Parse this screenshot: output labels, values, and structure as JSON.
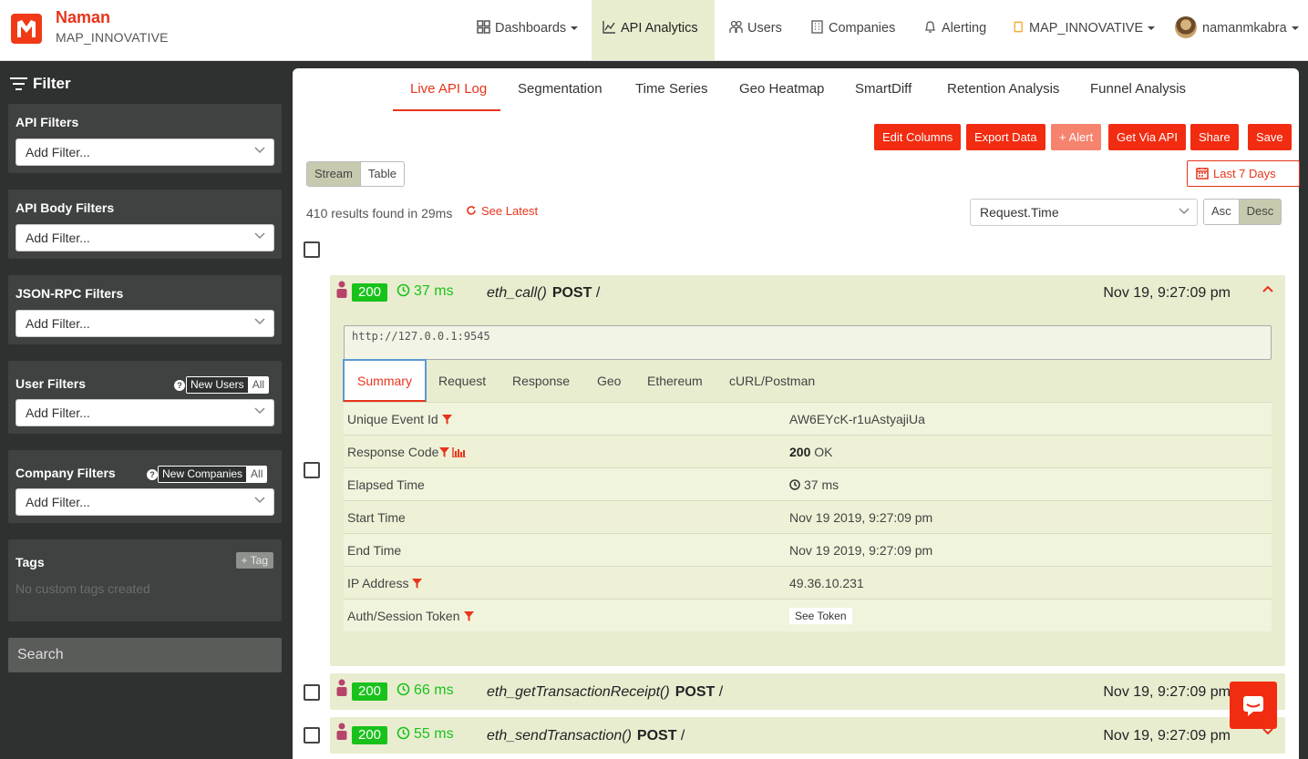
{
  "brand": {
    "name": "Naman",
    "org": "MAP_INNOVATIVE"
  },
  "nav": {
    "dashboards": "Dashboards",
    "api_analytics": "API Analytics",
    "users": "Users",
    "companies": "Companies",
    "alerting": "Alerting",
    "org_switch": "MAP_INNOVATIVE",
    "username": "namanmkabra"
  },
  "sidebar": {
    "title": "Filter",
    "api_filters": {
      "label": "API Filters",
      "placeholder": "Add Filter..."
    },
    "api_body_filters": {
      "label": "API Body Filters",
      "placeholder": "Add Filter..."
    },
    "jsonrpc_filters": {
      "label": "JSON-RPC Filters",
      "placeholder": "Add Filter..."
    },
    "user_filters": {
      "label": "User Filters",
      "placeholder": "Add Filter...",
      "toggle_on": "New Users",
      "toggle_off": "All"
    },
    "company_filters": {
      "label": "Company Filters",
      "placeholder": "Add Filter...",
      "toggle_on": "New Companies",
      "toggle_off": "All"
    },
    "tags": {
      "label": "Tags",
      "add_label": "+ Tag",
      "empty": "No custom tags created"
    },
    "search_placeholder": "Search"
  },
  "tabs": [
    "Live API Log",
    "Segmentation",
    "Time Series",
    "Geo Heatmap",
    "SmartDiff",
    "Retention Analysis",
    "Funnel Analysis"
  ],
  "actions": {
    "edit_columns": "Edit Columns",
    "export_data": "Export Data",
    "alert": "+ Alert",
    "get_via_api": "Get Via API",
    "share": "Share",
    "save": "Save"
  },
  "view_toggle": {
    "stream": "Stream",
    "table": "Table"
  },
  "daterange": "Last 7 Days",
  "results_text": "410 results found in 29ms",
  "see_latest": "See Latest",
  "sort": {
    "field": "Request.Time",
    "asc": "Asc",
    "desc": "Desc"
  },
  "events": [
    {
      "status": "200",
      "elapsed": "37 ms",
      "method": "eth_call()",
      "verb": "POST",
      "path": "/",
      "time": "Nov 19, 9:27:09 pm"
    },
    {
      "status": "200",
      "elapsed": "66 ms",
      "method": "eth_getTransactionReceipt()",
      "verb": "POST",
      "path": "/",
      "time": "Nov 19, 9:27:09 pm"
    },
    {
      "status": "200",
      "elapsed": "55 ms",
      "method": "eth_sendTransaction()",
      "verb": "POST",
      "path": "/",
      "time": "Nov 19, 9:27:09 pm"
    }
  ],
  "detail": {
    "url": "http://127.0.0.1:9545",
    "subtabs": [
      "Summary",
      "Request",
      "Response",
      "Geo",
      "Ethereum",
      "cURL/Postman"
    ],
    "rows": [
      {
        "key": "Unique Event Id",
        "value": "AW6EYcK-r1uAstyajiUa"
      },
      {
        "key": "Response Code",
        "value_code": "200",
        "value_text": "OK"
      },
      {
        "key": "Elapsed Time",
        "value": "37 ms"
      },
      {
        "key": "Start Time",
        "value": "Nov 19 2019, 9:27:09 pm"
      },
      {
        "key": "End Time",
        "value": "Nov 19 2019, 9:27:09 pm"
      },
      {
        "key": "IP Address",
        "value": "49.36.10.231"
      },
      {
        "key": "Auth/Session Token",
        "value": "See Token"
      }
    ]
  },
  "colors": {
    "accent": "#e8341a",
    "success": "#19c21b",
    "row_bg": "#e9edd0"
  }
}
